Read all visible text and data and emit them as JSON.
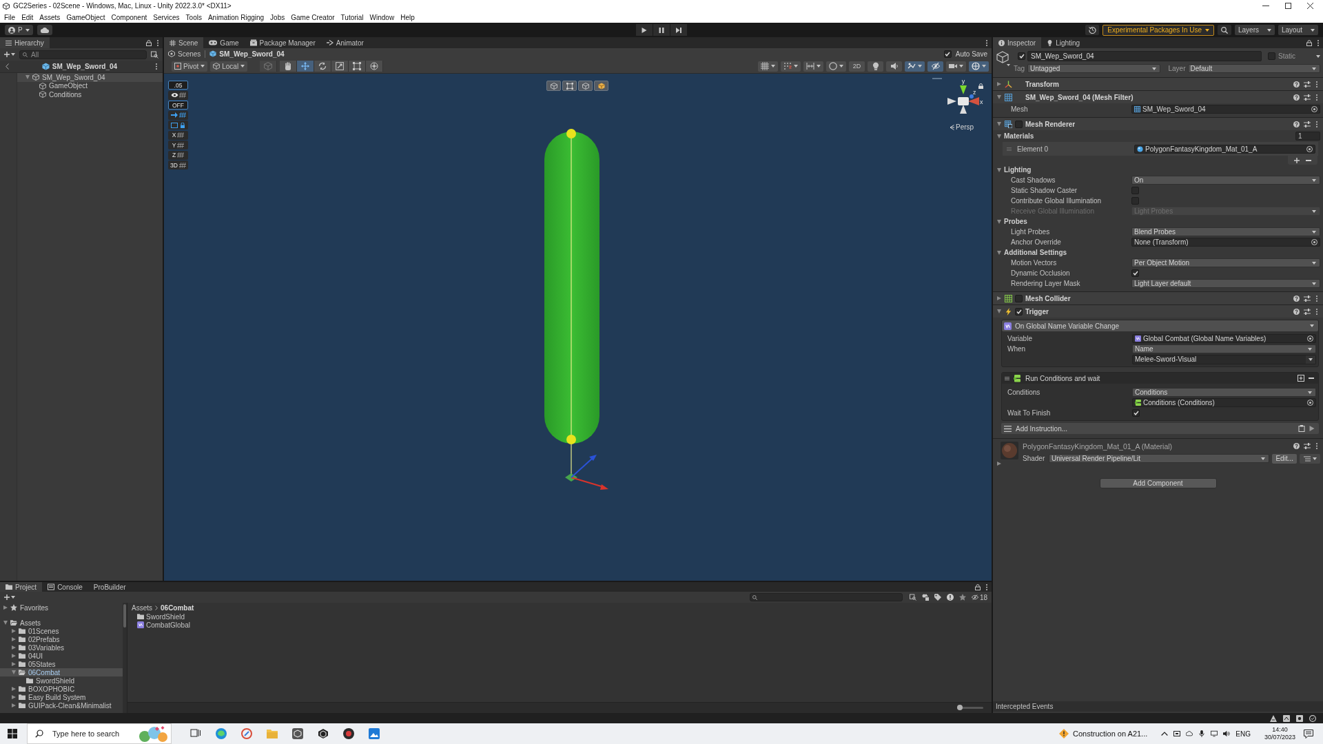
{
  "window": {
    "title": "GC2Series - 02Scene - Windows, Mac, Linux - Unity 2022.3.0* <DX11>"
  },
  "menu": [
    "File",
    "Edit",
    "Assets",
    "GameObject",
    "Component",
    "Services",
    "Tools",
    "Animation Rigging",
    "Jobs",
    "Game Creator",
    "Tutorial",
    "Window",
    "Help"
  ],
  "toolbar": {
    "account": "P",
    "notice": "Experimental Packages In Use",
    "layers": "Layers",
    "layout": "Layout"
  },
  "hierarchy": {
    "tab": "Hierarchy",
    "search_placeholder": "All",
    "context": "SM_Wep_Sword_04",
    "tree": [
      {
        "label": "SM_Wep_Sword_04",
        "expanded": true,
        "selected": true,
        "children": [
          {
            "label": "GameObject",
            "selected": false
          },
          {
            "label": "Conditions",
            "selected": false
          }
        ]
      }
    ]
  },
  "scene": {
    "tabs": [
      {
        "kind": "scene",
        "label": "Scene",
        "selected": true
      },
      {
        "kind": "game",
        "label": "Game",
        "selected": false
      },
      {
        "kind": "package",
        "label": "Package Manager",
        "selected": false
      },
      {
        "kind": "animator",
        "label": "Animator",
        "selected": false
      }
    ],
    "breadcrumb": [
      "Scenes",
      "SM_Wep_Sword_04"
    ],
    "auto_save": {
      "label": "Auto Save",
      "checked": true
    },
    "pivot": "Pivot",
    "space": "Local",
    "tools": [
      {
        "kind": "view",
        "selected": false
      },
      {
        "kind": "hand",
        "selected": false
      },
      {
        "kind": "move",
        "selected": true
      },
      {
        "kind": "rotate",
        "selected": false
      },
      {
        "kind": "scale",
        "selected": false
      },
      {
        "kind": "rect",
        "selected": false
      },
      {
        "kind": "transform",
        "selected": false
      }
    ],
    "view_options": [
      {
        "kind": "grid",
        "on": false
      },
      {
        "kind": "snap",
        "on": false
      },
      {
        "kind": "increment",
        "on": false
      },
      {
        "kind": "shading",
        "on": false
      },
      {
        "kind": "flat",
        "label": "2D",
        "on": false
      },
      {
        "kind": "lighting",
        "on": false
      },
      {
        "kind": "audio",
        "on": false
      },
      {
        "kind": "effects",
        "on": true
      },
      {
        "kind": "visibility",
        "on": true
      },
      {
        "kind": "camera",
        "on": false
      },
      {
        "kind": "gizmos",
        "on": true
      }
    ],
    "overlay": [
      {
        "kind": "value",
        "label": ".05"
      },
      {
        "kind": "visibility"
      },
      {
        "kind": "value",
        "label": "OFF"
      },
      {
        "kind": "move"
      },
      {
        "kind": "lock"
      },
      {
        "kind": "axis",
        "label": "X"
      },
      {
        "kind": "axis",
        "label": "Y"
      },
      {
        "kind": "axis",
        "label": "Z"
      },
      {
        "kind": "axis",
        "label": "3D"
      }
    ],
    "gizmo_axes": [
      "y",
      "z",
      "x"
    ],
    "projection": "Persp"
  },
  "inspector": {
    "tabs": [
      {
        "kind": "info",
        "label": "Inspector",
        "selected": true
      },
      {
        "kind": "light",
        "label": "Lighting",
        "selected": false
      }
    ],
    "object": {
      "active": true,
      "name": "SM_Wep_Sword_04",
      "static": false,
      "static_label": "Static",
      "tag_label": "Tag",
      "tag": "Untagged",
      "layer_label": "Layer",
      "layer": "Default"
    },
    "components": [
      {
        "kind": "transform",
        "title": "Transform",
        "expanded": false
      },
      {
        "kind": "mesh_filter",
        "title": "SM_Wep_Sword_04 (Mesh Filter)",
        "expanded": true,
        "rows": [
          {
            "kind": "object",
            "label": "Mesh",
            "value": "SM_Wep_Sword_04"
          }
        ]
      },
      {
        "kind": "mesh_renderer",
        "title": "Mesh Renderer",
        "expanded": true,
        "enabled": false,
        "rows": [
          {
            "kind": "foldout",
            "label": "Materials",
            "expanded": true,
            "count": "1",
            "disabled": false
          },
          {
            "kind": "element",
            "label": "Element 0",
            "value": "PolygonFantasyKingdom_Mat_01_A",
            "disabled": false
          },
          {
            "kind": "list_footer",
            "disabled": false
          },
          {
            "kind": "foldout",
            "label": "Lighting",
            "expanded": true,
            "disabled": false
          },
          {
            "kind": "dropdown",
            "label": "Cast Shadows",
            "value": "On",
            "disabled": false
          },
          {
            "kind": "checkbox",
            "label": "Static Shadow Caster",
            "checked": false,
            "disabled": false
          },
          {
            "kind": "checkbox",
            "label": "Contribute Global Illumination",
            "checked": false,
            "disabled": false
          },
          {
            "kind": "dropdown",
            "label": "Receive Global Illumination",
            "value": "Light Probes",
            "disabled": true
          },
          {
            "kind": "foldout",
            "label": "Probes",
            "expanded": true,
            "disabled": false
          },
          {
            "kind": "dropdown",
            "label": "Light Probes",
            "value": "Blend Probes",
            "disabled": false
          },
          {
            "kind": "object",
            "label": "Anchor Override",
            "value": "None (Transform)",
            "disabled": false
          },
          {
            "kind": "foldout",
            "label": "Additional Settings",
            "expanded": true,
            "disabled": false
          },
          {
            "kind": "dropdown",
            "label": "Motion Vectors",
            "value": "Per Object Motion",
            "disabled": false
          },
          {
            "kind": "checkbox",
            "label": "Dynamic Occlusion",
            "checked": true,
            "disabled": false
          },
          {
            "kind": "dropdown",
            "label": "Rendering Layer Mask",
            "value": "Light Layer default",
            "disabled": false
          }
        ]
      },
      {
        "kind": "mesh_collider",
        "title": "Mesh Collider",
        "expanded": false,
        "enabled": false
      },
      {
        "kind": "trigger",
        "title": "Trigger",
        "expanded": true,
        "enabled": true,
        "event": {
          "title": "On Global Name Variable Change",
          "rows": [
            {
              "kind": "object",
              "label": "Variable",
              "value": "Global Combat (Global Name Variables)"
            },
            {
              "kind": "dropdown",
              "label": "When",
              "value": "Name"
            },
            {
              "kind": "combo",
              "value": "Melee-Sword-Visual"
            }
          ]
        },
        "instructions": [
          {
            "title": "Run Conditions and wait",
            "rows": [
              {
                "kind": "dropdown",
                "label": "Conditions",
                "value": "Conditions"
              },
              {
                "kind": "object",
                "value": "Conditions (Conditions)"
              },
              {
                "kind": "checkbox",
                "label": "Wait To Finish",
                "checked": true
              }
            ]
          }
        ],
        "add_instruction": "Add Instruction..."
      }
    ],
    "material": {
      "title": "PolygonFantasyKingdom_Mat_01_A (Material)",
      "expanded": false,
      "shader_label": "Shader",
      "shader": "Universal Render Pipeline/Lit",
      "edit": "Edit..."
    },
    "add_component": "Add Component",
    "footer": "Intercepted Events"
  },
  "project": {
    "tabs": [
      {
        "kind": "folder",
        "label": "Project",
        "selected": true
      },
      {
        "kind": "console",
        "label": "Console",
        "selected": false
      },
      {
        "kind": "none",
        "label": "ProBuilder",
        "selected": false
      }
    ],
    "hidden_count": "18",
    "tree": [
      {
        "kind": "favorites",
        "label": "Favorites",
        "expanded": false,
        "selected": false
      },
      {
        "kind": "folder",
        "label": "Assets",
        "expanded": true,
        "selected": false,
        "children": [
          {
            "kind": "folder",
            "label": "01Scenes",
            "expanded": false,
            "selected": false
          },
          {
            "kind": "folder",
            "label": "02Prefabs",
            "expanded": false,
            "selected": false
          },
          {
            "kind": "folder",
            "label": "03Variables",
            "expanded": false,
            "selected": false
          },
          {
            "kind": "folder",
            "label": "04UI",
            "expanded": false,
            "selected": false
          },
          {
            "kind": "folder",
            "label": "05States",
            "expanded": false,
            "selected": false
          },
          {
            "kind": "folder",
            "label": "06Combat",
            "expanded": true,
            "selected": true,
            "children": [
              {
                "kind": "folder",
                "label": "SwordShield",
                "selected": false
              }
            ]
          },
          {
            "kind": "folder",
            "label": "BOXOPHOBIC",
            "expanded": false,
            "selected": false
          },
          {
            "kind": "folder",
            "label": "Easy Build System",
            "expanded": false,
            "selected": false
          },
          {
            "kind": "folder",
            "label": "GUIPack-Clean&Minimalist",
            "expanded": false,
            "selected": false
          }
        ]
      }
    ],
    "breadcrumb": [
      "Assets",
      "06Combat"
    ],
    "items": [
      {
        "kind": "folder",
        "label": "SwordShield"
      },
      {
        "kind": "variables",
        "label": "CombatGlobal"
      }
    ],
    "icon_size": {
      "level": 0.05
    }
  },
  "taskbar": {
    "search_placeholder": "Type here to search",
    "news": "Construction on A21...",
    "language": "ENG",
    "time": "14:40",
    "date": "30/07/2023"
  }
}
